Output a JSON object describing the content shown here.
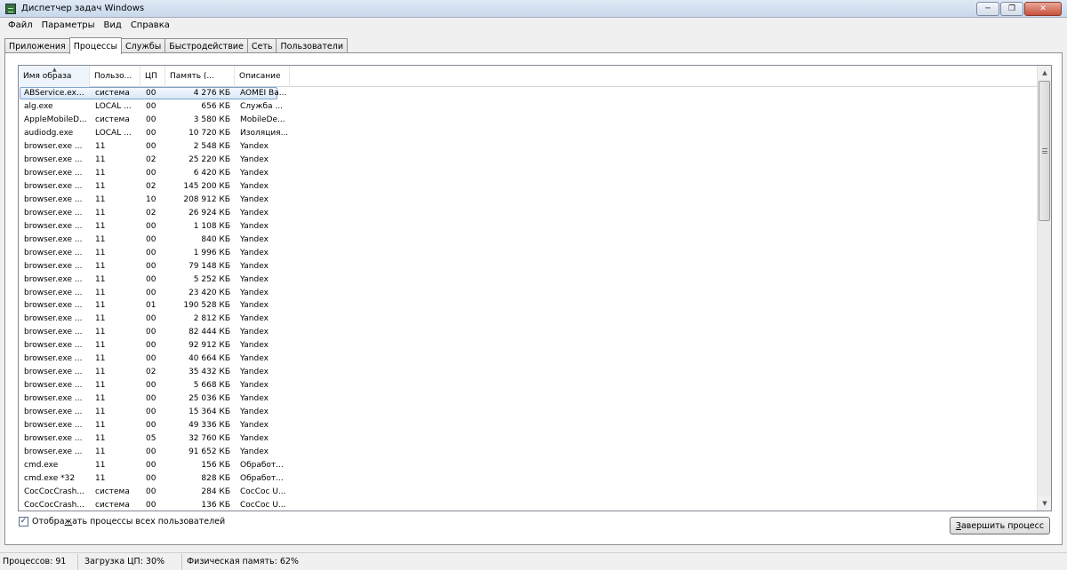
{
  "window": {
    "title": "Диспетчер задач Windows",
    "minimize_icon": "minimize-icon",
    "restore_icon": "restore-icon",
    "close_icon": "close-icon"
  },
  "menu": [
    "Файл",
    "Параметры",
    "Вид",
    "Справка"
  ],
  "tabs": [
    "Приложения",
    "Процессы",
    "Службы",
    "Быстродействие",
    "Сеть",
    "Пользователи"
  ],
  "active_tab": "Процессы",
  "columns": [
    "Имя образа",
    "Пользо...",
    "ЦП",
    "Память (...",
    "Описание"
  ],
  "sorted_column": "Имя образа",
  "processes": [
    {
      "name": "ABService.ex...",
      "user": "система",
      "cpu": "00",
      "mem": "4 276 КБ",
      "desc": "AOMEI Ba..."
    },
    {
      "name": "alg.exe",
      "user": "LOCAL ...",
      "cpu": "00",
      "mem": "656 КБ",
      "desc": "Служба ..."
    },
    {
      "name": "AppleMobileD...",
      "user": "система",
      "cpu": "00",
      "mem": "3 580 КБ",
      "desc": "MobileDe..."
    },
    {
      "name": "audiodg.exe",
      "user": "LOCAL ...",
      "cpu": "00",
      "mem": "10 720 КБ",
      "desc": "Изоляция..."
    },
    {
      "name": "browser.exe ...",
      "user": "11",
      "cpu": "00",
      "mem": "2 548 КБ",
      "desc": "Yandex"
    },
    {
      "name": "browser.exe ...",
      "user": "11",
      "cpu": "02",
      "mem": "25 220 КБ",
      "desc": "Yandex"
    },
    {
      "name": "browser.exe ...",
      "user": "11",
      "cpu": "00",
      "mem": "6 420 КБ",
      "desc": "Yandex"
    },
    {
      "name": "browser.exe ...",
      "user": "11",
      "cpu": "02",
      "mem": "145 200 КБ",
      "desc": "Yandex"
    },
    {
      "name": "browser.exe ...",
      "user": "11",
      "cpu": "10",
      "mem": "208 912 КБ",
      "desc": "Yandex"
    },
    {
      "name": "browser.exe ...",
      "user": "11",
      "cpu": "02",
      "mem": "26 924 КБ",
      "desc": "Yandex"
    },
    {
      "name": "browser.exe ...",
      "user": "11",
      "cpu": "00",
      "mem": "1 108 КБ",
      "desc": "Yandex"
    },
    {
      "name": "browser.exe ...",
      "user": "11",
      "cpu": "00",
      "mem": "840 КБ",
      "desc": "Yandex"
    },
    {
      "name": "browser.exe ...",
      "user": "11",
      "cpu": "00",
      "mem": "1 996 КБ",
      "desc": "Yandex"
    },
    {
      "name": "browser.exe ...",
      "user": "11",
      "cpu": "00",
      "mem": "79 148 КБ",
      "desc": "Yandex"
    },
    {
      "name": "browser.exe ...",
      "user": "11",
      "cpu": "00",
      "mem": "5 252 КБ",
      "desc": "Yandex"
    },
    {
      "name": "browser.exe ...",
      "user": "11",
      "cpu": "00",
      "mem": "23 420 КБ",
      "desc": "Yandex"
    },
    {
      "name": "browser.exe ...",
      "user": "11",
      "cpu": "01",
      "mem": "190 528 КБ",
      "desc": "Yandex"
    },
    {
      "name": "browser.exe ...",
      "user": "11",
      "cpu": "00",
      "mem": "2 812 КБ",
      "desc": "Yandex"
    },
    {
      "name": "browser.exe ...",
      "user": "11",
      "cpu": "00",
      "mem": "82 444 КБ",
      "desc": "Yandex"
    },
    {
      "name": "browser.exe ...",
      "user": "11",
      "cpu": "00",
      "mem": "92 912 КБ",
      "desc": "Yandex"
    },
    {
      "name": "browser.exe ...",
      "user": "11",
      "cpu": "00",
      "mem": "40 664 КБ",
      "desc": "Yandex"
    },
    {
      "name": "browser.exe ...",
      "user": "11",
      "cpu": "02",
      "mem": "35 432 КБ",
      "desc": "Yandex"
    },
    {
      "name": "browser.exe ...",
      "user": "11",
      "cpu": "00",
      "mem": "5 668 КБ",
      "desc": "Yandex"
    },
    {
      "name": "browser.exe ...",
      "user": "11",
      "cpu": "00",
      "mem": "25 036 КБ",
      "desc": "Yandex"
    },
    {
      "name": "browser.exe ...",
      "user": "11",
      "cpu": "00",
      "mem": "15 364 КБ",
      "desc": "Yandex"
    },
    {
      "name": "browser.exe ...",
      "user": "11",
      "cpu": "00",
      "mem": "49 336 КБ",
      "desc": "Yandex"
    },
    {
      "name": "browser.exe ...",
      "user": "11",
      "cpu": "05",
      "mem": "32 760 КБ",
      "desc": "Yandex"
    },
    {
      "name": "browser.exe ...",
      "user": "11",
      "cpu": "00",
      "mem": "91 652 КБ",
      "desc": "Yandex"
    },
    {
      "name": "cmd.exe",
      "user": "11",
      "cpu": "00",
      "mem": "156 КБ",
      "desc": "Обработ..."
    },
    {
      "name": "cmd.exe *32",
      "user": "11",
      "cpu": "00",
      "mem": "828 КБ",
      "desc": "Обработ..."
    },
    {
      "name": "CocCocCrash...",
      "user": "система",
      "cpu": "00",
      "mem": "284 КБ",
      "desc": "CocCoc U..."
    },
    {
      "name": "CocCocCrash...",
      "user": "система",
      "cpu": "00",
      "mem": "136 КБ",
      "desc": "CocCoc U..."
    }
  ],
  "selected_row": 0,
  "show_all_users": {
    "label_before": "Отобра",
    "label_underlined": "ж",
    "label_after": "ать процессы всех пользователей",
    "checked": true
  },
  "end_process_button": {
    "label_before": "",
    "label_underlined": "З",
    "label_after": "авершить процесс"
  },
  "status": {
    "processes": "Процессов: 91",
    "cpu": "Загрузка ЦП: 30%",
    "memory": "Физическая память: 62%"
  }
}
